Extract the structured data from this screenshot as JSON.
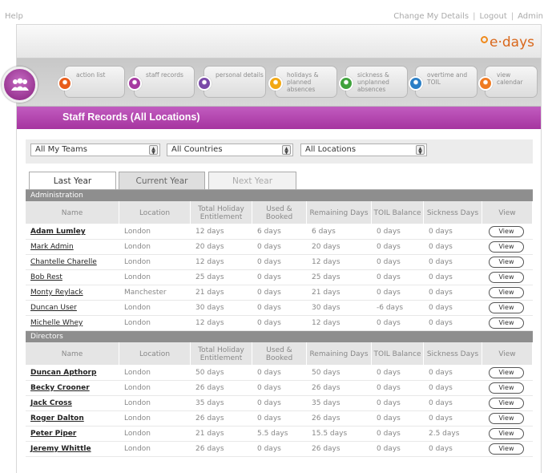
{
  "top": {
    "help": "Help",
    "links": [
      "Change My Details",
      "Logout",
      "Admin"
    ]
  },
  "logo": "e·days",
  "nav": [
    {
      "label": "action list",
      "color": "#e85c1a"
    },
    {
      "label": "staff records",
      "color": "#a63aa1"
    },
    {
      "label": "personal details",
      "color": "#7a4aa8"
    },
    {
      "label": "holidays & planned absences",
      "color": "#f2a814"
    },
    {
      "label": "sickness & unplanned absences",
      "color": "#3fa23c"
    },
    {
      "label": "overtime and TOIL",
      "color": "#2b7fc6"
    },
    {
      "label": "view calendar",
      "color": "#ef7b22"
    }
  ],
  "page_title": "Staff Records (All Locations)",
  "filters": {
    "teams": "All My Teams",
    "countries": "All Countries",
    "locations": "All Locations"
  },
  "tabs": [
    "Last Year",
    "Current Year",
    "Next Year"
  ],
  "columns": [
    "Name",
    "Location",
    "Total Holiday Entitlement",
    "Used & Booked",
    "Remaining Days",
    "TOIL Balance",
    "Sickness Days",
    "View"
  ],
  "view_label": "View",
  "sections": [
    {
      "title": "Administration",
      "rows": [
        [
          "Adam Lumley",
          "London",
          "12 days",
          "6 days",
          "6 days",
          "0 days",
          "0 days"
        ],
        [
          "Mark Admin",
          "London",
          "20 days",
          "0 days",
          "20 days",
          "0 days",
          "0 days"
        ],
        [
          "Chantelle Charelle",
          "London",
          "12 days",
          "0 days",
          "12 days",
          "0 days",
          "0 days"
        ],
        [
          "Bob Rest",
          "London",
          "25 days",
          "0 days",
          "25 days",
          "0 days",
          "0 days"
        ],
        [
          "Monty Reylack",
          "Manchester",
          "21 days",
          "0 days",
          "21 days",
          "0 days",
          "0 days"
        ],
        [
          "Duncan User",
          "London",
          "30 days",
          "0 days",
          "30 days",
          "-6 days",
          "0 days"
        ],
        [
          "Michelle Whey",
          "London",
          "12 days",
          "0 days",
          "12 days",
          "0 days",
          "0 days"
        ]
      ],
      "bold": [
        true,
        false,
        false,
        false,
        false,
        false,
        false
      ]
    },
    {
      "title": "Directors",
      "rows": [
        [
          "Duncan Apthorp",
          "London",
          "50 days",
          "0 days",
          "50 days",
          "0 days",
          "0 days"
        ],
        [
          "Becky Crooner",
          "London",
          "26 days",
          "0 days",
          "26 days",
          "0 days",
          "0 days"
        ],
        [
          "Jack Cross",
          "London",
          "35 days",
          "0 days",
          "35 days",
          "0 days",
          "0 days"
        ],
        [
          "Roger Dalton",
          "London",
          "26 days",
          "0 days",
          "26 days",
          "0 days",
          "0 days"
        ],
        [
          "Peter Piper",
          "London",
          "21 days",
          "5.5 days",
          "15.5 days",
          "0 days",
          "2.5 days"
        ],
        [
          "Jeremy Whittle",
          "London",
          "26 days",
          "0 days",
          "26 days",
          "0 days",
          "0 days"
        ]
      ],
      "bold": [
        true,
        true,
        true,
        true,
        true,
        true
      ]
    }
  ]
}
